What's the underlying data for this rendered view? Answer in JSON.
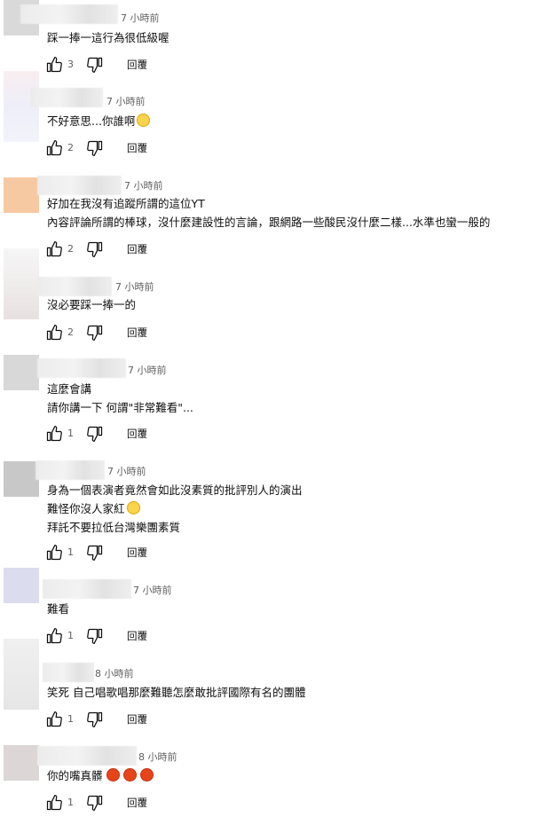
{
  "reply_label": "回覆",
  "comments": [
    {
      "time": "7 小時前",
      "lines": [
        "踩一捧一這行為很低級喔"
      ],
      "likes": "3",
      "avatar_color": "#d9d9d9"
    },
    {
      "time": "7 小時前",
      "lines": [
        "不好意思...你誰啊"
      ],
      "likes": "2",
      "avatar_color": "#eeeef8",
      "emoji": "face-with-rolling-eyes"
    },
    {
      "time": "7 小時前",
      "lines": [
        "好加在我沒有追蹤所謂的這位YT",
        "內容評論所謂的棒球，沒什麼建設性的言論，跟網路一些酸民沒什麼二樣...水準也蠻一般的"
      ],
      "likes": "2",
      "avatar_color": "#f7c9a3"
    },
    {
      "time": "7 小時前",
      "lines": [
        "沒必要踩一捧一的"
      ],
      "likes": "2",
      "avatar_color": "#ebe4e4"
    },
    {
      "time": "7 小時前",
      "lines": [
        "這麼會講",
        "請你講一下  何謂\"非常難看\"..."
      ],
      "likes": "1",
      "avatar_color": "#d8d8d8"
    },
    {
      "time": "7 小時前",
      "lines": [
        "身為一個表演者竟然會如此沒素質的批評別人的演出",
        "難怪你沒人家紅",
        "拜託不要拉低台灣樂團素質"
      ],
      "likes": "1",
      "avatar_color": "#c8c8c8",
      "line_emoji": {
        "1": "face-with-tears-of-joy"
      }
    },
    {
      "time": "7 小時前",
      "lines": [
        "難看"
      ],
      "likes": "1",
      "avatar_color": "#dcdcef"
    },
    {
      "time": "8 小時前",
      "lines": [
        "笑死 自己唱歌唱那麼難聽怎麼敢批評國際有名的團體"
      ],
      "likes": "1",
      "avatar_color": "#e3e3e3"
    },
    {
      "time": "8 小時前",
      "lines": [
        "你的嘴真髒"
      ],
      "likes": "1",
      "avatar_color": "#dcd6d6",
      "emoji_angry_count": 3
    }
  ]
}
